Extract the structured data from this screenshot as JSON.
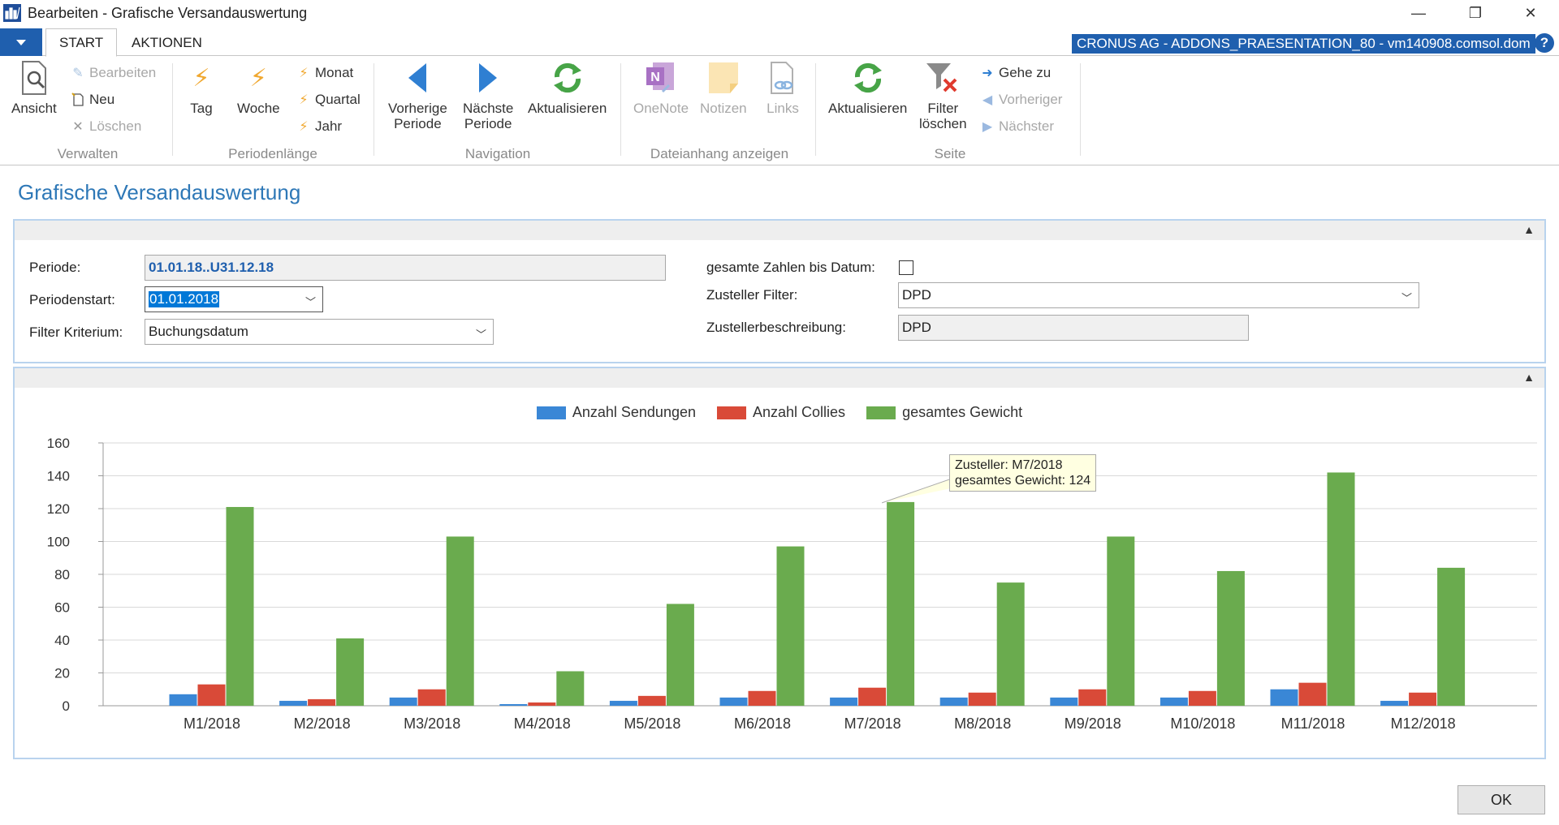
{
  "window": {
    "title": "Bearbeiten - Grafische Versandauswertung",
    "min": "—",
    "restore": "❐",
    "close": "✕"
  },
  "tabs": {
    "start": "START",
    "aktionen": "AKTIONEN"
  },
  "company": "CRONUS AG - ADDONS_PRAESENTATION_80 - vm140908.comsol.dom",
  "help": "?",
  "ribbon": {
    "verwalten": {
      "label": "Verwalten",
      "ansicht": "Ansicht",
      "bearbeiten": "Bearbeiten",
      "neu": "Neu",
      "loeschen": "Löschen"
    },
    "periodenlaenge": {
      "label": "Periodenlänge",
      "tag": "Tag",
      "woche": "Woche",
      "monat": "Monat",
      "quartal": "Quartal",
      "jahr": "Jahr"
    },
    "navigation": {
      "label": "Navigation",
      "vorherige_1": "Vorherige",
      "vorherige_2": "Periode",
      "naechste_1": "Nächste",
      "naechste_2": "Periode",
      "aktualisieren": "Aktualisieren"
    },
    "dateianhang": {
      "label": "Dateianhang anzeigen",
      "onenote": "OneNote",
      "notizen": "Notizen",
      "links": "Links"
    },
    "seite": {
      "label": "Seite",
      "aktualisieren": "Aktualisieren",
      "filter_1": "Filter",
      "filter_2": "löschen",
      "gehe_zu": "Gehe zu",
      "vorheriger": "Vorheriger",
      "naechster": "Nächster"
    }
  },
  "page_title": "Grafische Versandauswertung",
  "form": {
    "periode_label": "Periode:",
    "periode_value": "01.01.18..U31.12.18",
    "periodenstart_label": "Periodenstart:",
    "periodenstart_value": "01.01.2018",
    "filter_label": "Filter Kriterium:",
    "filter_value": "Buchungsdatum",
    "gesamte_label": "gesamte Zahlen bis Datum:",
    "gesamte_checked": false,
    "zusteller_filter_label": "Zusteller Filter:",
    "zusteller_filter_value": "DPD",
    "zusteller_beschr_label": "Zustellerbeschreibung:",
    "zusteller_beschr_value": "DPD"
  },
  "chart_data": {
    "type": "bar",
    "categories": [
      "M1/2018",
      "M2/2018",
      "M3/2018",
      "M4/2018",
      "M5/2018",
      "M6/2018",
      "M7/2018",
      "M8/2018",
      "M9/2018",
      "M10/2018",
      "M11/2018",
      "M12/2018"
    ],
    "series": [
      {
        "name": "Anzahl Sendungen",
        "color": "#3a87d6",
        "values": [
          7,
          3,
          5,
          1,
          3,
          5,
          5,
          5,
          5,
          5,
          10,
          3
        ]
      },
      {
        "name": "Anzahl Collies",
        "color": "#d94a38",
        "values": [
          13,
          4,
          10,
          2,
          6,
          9,
          11,
          8,
          10,
          9,
          14,
          8
        ]
      },
      {
        "name": "gesamtes Gewicht",
        "color": "#6aab4e",
        "values": [
          121,
          41,
          103,
          21,
          62,
          97,
          124,
          75,
          103,
          82,
          142,
          84
        ]
      }
    ],
    "ylim": [
      0,
      160
    ],
    "yticks": [
      "0",
      "20",
      "40",
      "60",
      "80",
      "100",
      "120",
      "140",
      "160"
    ],
    "grid": true,
    "legend_position": "top-center",
    "tooltip": {
      "line1": "Zusteller: M7/2018",
      "line2": "gesamtes Gewicht: 124"
    }
  },
  "ok_label": "OK"
}
